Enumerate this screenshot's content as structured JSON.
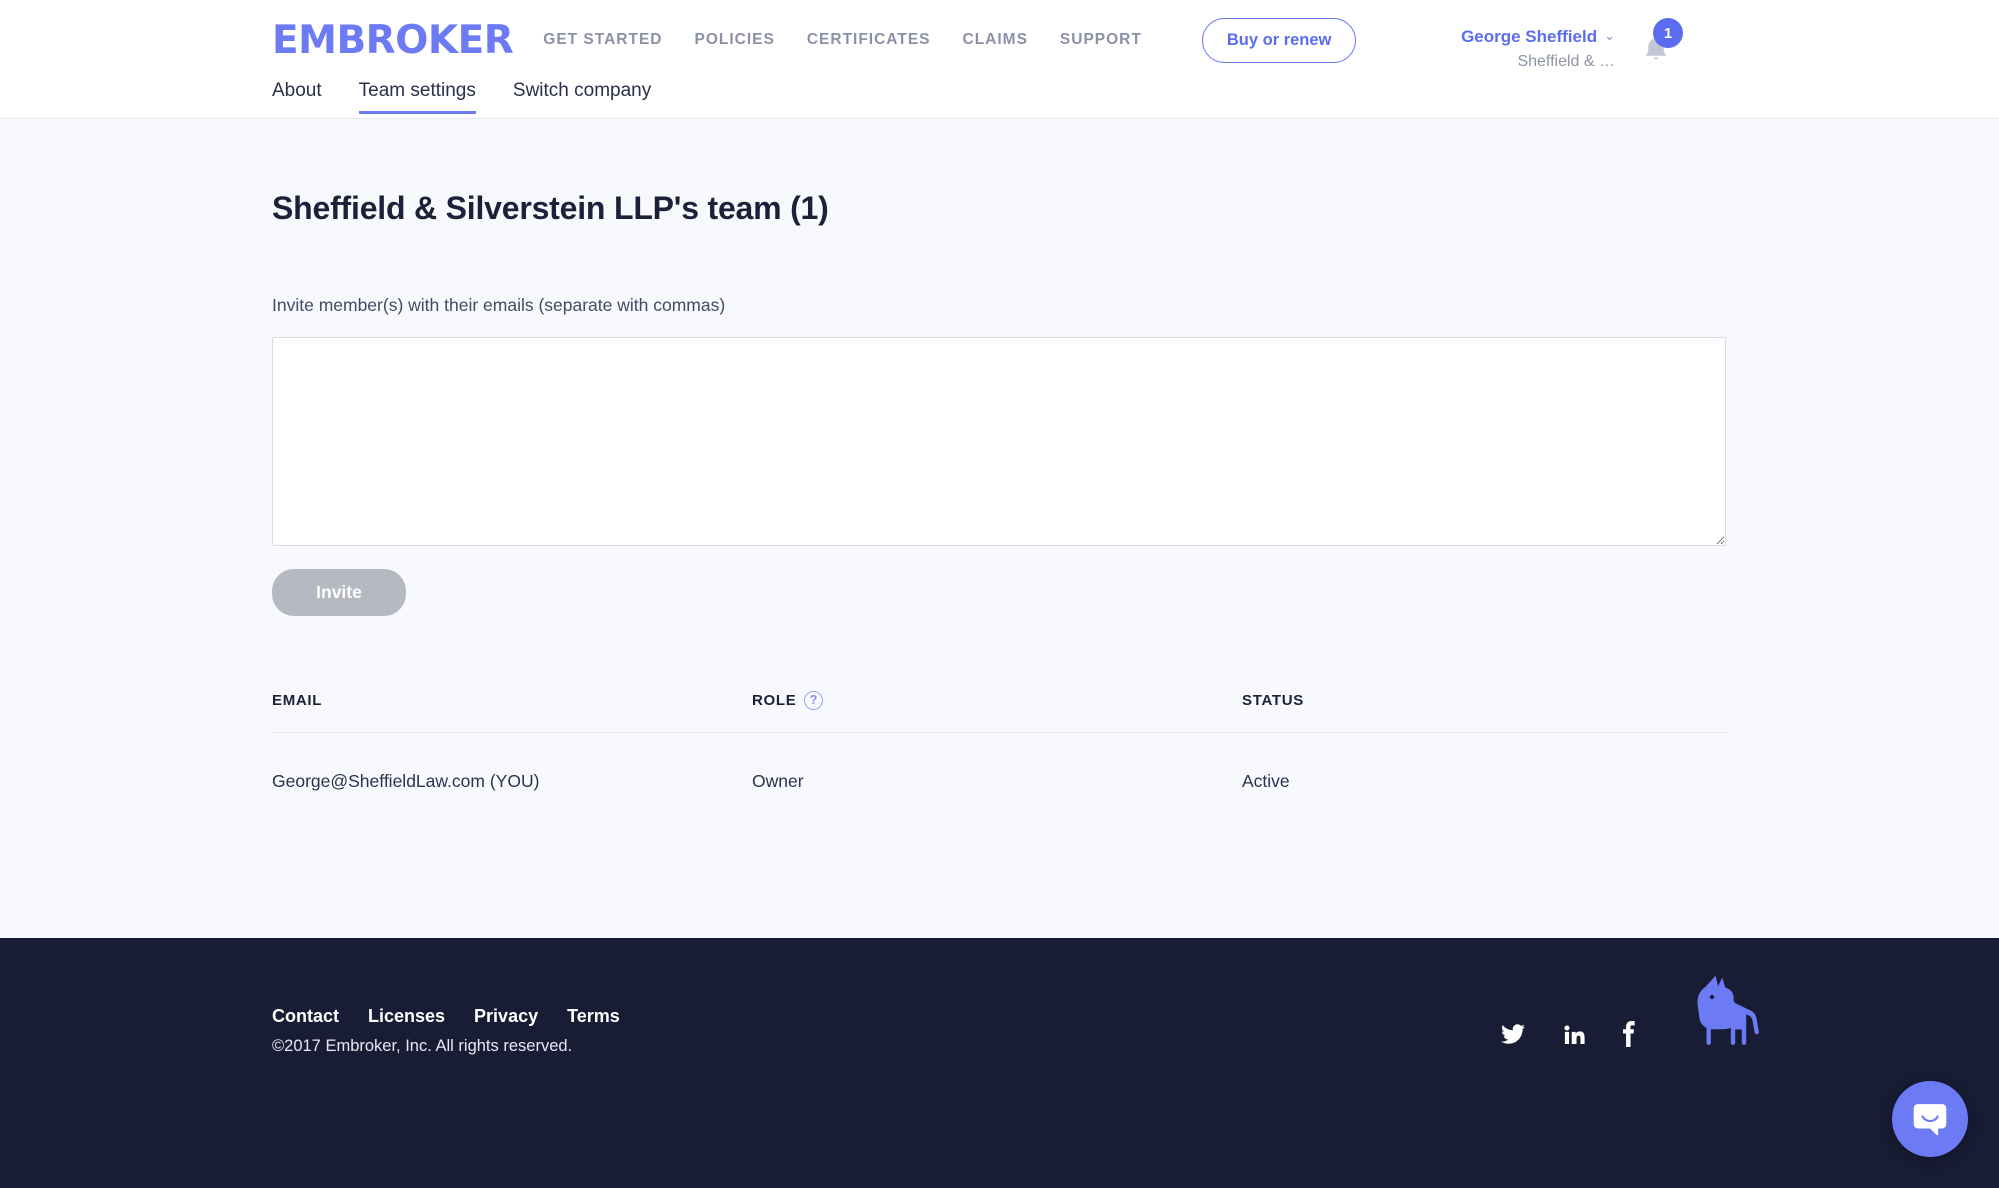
{
  "header": {
    "logo_text": "EMBROKER",
    "nav": [
      {
        "label": "GET STARTED"
      },
      {
        "label": "POLICIES"
      },
      {
        "label": "CERTIFICATES"
      },
      {
        "label": "CLAIMS"
      },
      {
        "label": "SUPPORT"
      }
    ],
    "buy_button": "Buy or renew",
    "user": {
      "name": "George Sheffield",
      "company": "Sheffield & …",
      "caret": "⌄"
    },
    "notifications": {
      "count": "1",
      "icon": "bell-icon"
    },
    "subnav": [
      {
        "label": "About",
        "active": false
      },
      {
        "label": "Team settings",
        "active": true
      },
      {
        "label": "Switch company",
        "active": false
      }
    ]
  },
  "main": {
    "page_title": "Sheffield & Silverstein LLP's team (1)",
    "invite_label": "Invite member(s) with their emails (separate with commas)",
    "invite_textarea_value": "",
    "invite_textarea_placeholder": "",
    "invite_button": "Invite",
    "table": {
      "columns": [
        "EMAIL",
        "ROLE",
        "STATUS"
      ],
      "role_help_glyph": "?",
      "rows": [
        {
          "email": "George@SheffieldLaw.com (YOU)",
          "role": "Owner",
          "status": "Active"
        }
      ]
    }
  },
  "footer": {
    "links": [
      {
        "label": "Contact"
      },
      {
        "label": "Licenses"
      },
      {
        "label": "Privacy"
      },
      {
        "label": "Terms"
      }
    ],
    "copyright": "©2017 Embroker, Inc. All rights reserved.",
    "socials": [
      {
        "name": "twitter-icon"
      },
      {
        "name": "linkedin-icon"
      },
      {
        "name": "facebook-icon"
      }
    ]
  },
  "chat": {
    "icon": "chat-bubble-icon"
  },
  "colors": {
    "brand_periwinkle": "#6C7BF4",
    "brand_indigo": "#5A6CF0",
    "footer_navy": "#181C34",
    "page_background": "#F8F9FD",
    "nav_grey": "#8B90A8",
    "disabled_button": "#B6B9C2"
  }
}
